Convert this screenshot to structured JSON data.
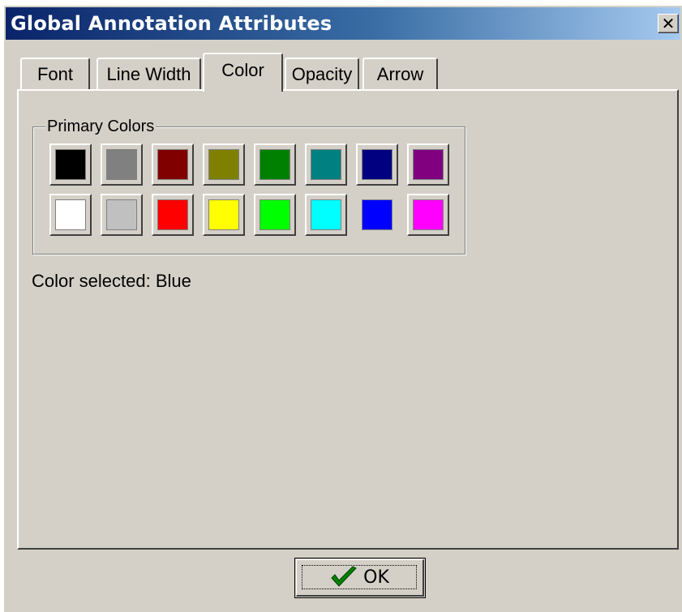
{
  "window": {
    "title": "Global Annotation Attributes",
    "close_icon": "close-icon"
  },
  "tabs": [
    {
      "label": "Font",
      "active": false
    },
    {
      "label": "Line Width",
      "active": false
    },
    {
      "label": "Color",
      "active": true
    },
    {
      "label": "Opacity",
      "active": false
    },
    {
      "label": "Arrow",
      "active": false
    }
  ],
  "color_panel": {
    "group_label": "Primary Colors",
    "swatches": [
      {
        "color": "#000000"
      },
      {
        "color": "#808080"
      },
      {
        "color": "#800000"
      },
      {
        "color": "#808000"
      },
      {
        "color": "#008000"
      },
      {
        "color": "#008080"
      },
      {
        "color": "#000080"
      },
      {
        "color": "#800080"
      },
      {
        "color": "#ffffff"
      },
      {
        "color": "#c0c0c0"
      },
      {
        "color": "#ff0000"
      },
      {
        "color": "#ffff00"
      },
      {
        "color": "#00ff00"
      },
      {
        "color": "#00ffff"
      },
      {
        "color": "#0000ff",
        "selected": true
      },
      {
        "color": "#ff00ff"
      }
    ],
    "selected_text": "Color selected: Blue"
  },
  "ok_button": {
    "label": "OK",
    "icon": "checkmark-icon",
    "icon_color": "#008000"
  }
}
